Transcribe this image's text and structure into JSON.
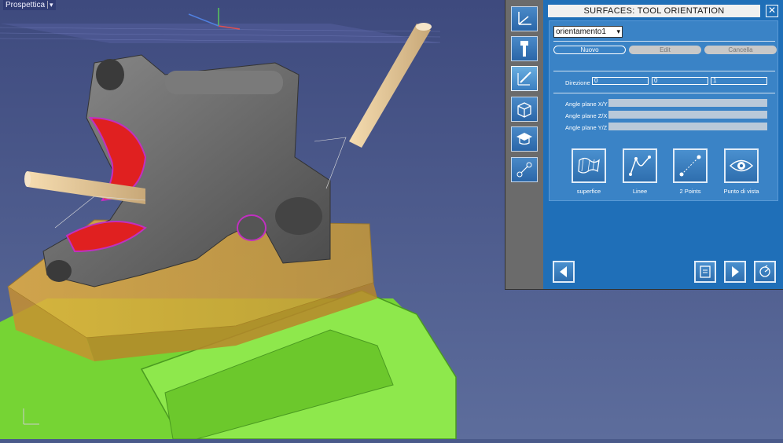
{
  "viewport": {
    "label": "Prospettica",
    "label_arrow": "▾"
  },
  "panel": {
    "title": "SURFACES: TOOL ORIENTATION",
    "close_glyph": "✕",
    "orientation_select": {
      "value": "orientamento1",
      "caret": "▾"
    },
    "buttons": {
      "nuovo": "Nuovo",
      "edit": "Edit",
      "cancella": "Cancella"
    },
    "direction": {
      "label": "Direzione",
      "x": "0",
      "y": "0",
      "z": "1"
    },
    "angles": [
      {
        "label": "Angle plane X/Y",
        "value": ""
      },
      {
        "label": "Angle plane Z/X",
        "value": ""
      },
      {
        "label": "Angle plane Y/Z",
        "value": ""
      }
    ],
    "modes": [
      {
        "label": "superfice",
        "icon": "surface-icon"
      },
      {
        "label": "Linee",
        "icon": "curve-lines-icon"
      },
      {
        "label": "2 Points",
        "icon": "two-points-icon"
      },
      {
        "label": "Punto di vista",
        "icon": "eye-icon"
      }
    ],
    "sidebar_icons": [
      "axes-icon",
      "tool-icon",
      "tool-orientation-icon",
      "box-icon",
      "graduation-cap-icon",
      "points-transform-icon"
    ],
    "nav_icons": [
      "back-arrow-icon",
      "save-file-icon",
      "next-arrow-icon",
      "simulate-icon"
    ]
  },
  "colors": {
    "panel_blue": "#1f6fb8",
    "inner_blue": "#3a83c6",
    "vise_green": "#7ee03a",
    "stock_orange": "#d8a83a",
    "background": "#4a5a8a"
  }
}
